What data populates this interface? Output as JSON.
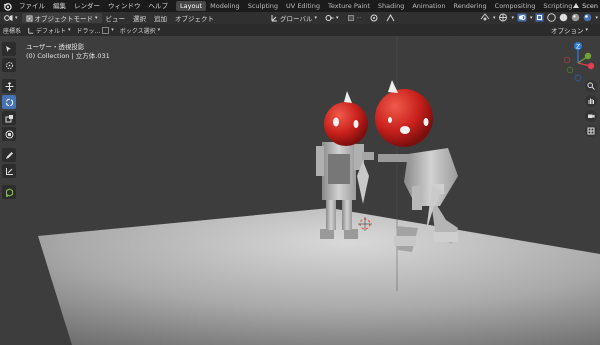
{
  "menubar": {
    "menus": [
      "ファイル",
      "編集",
      "レンダー",
      "ウィンドウ",
      "ヘルプ"
    ],
    "workspaces": [
      "Layout",
      "Modeling",
      "Sculpting",
      "UV Editing",
      "Texture Paint",
      "Shading",
      "Animation",
      "Rendering",
      "Compositing",
      "Scripting"
    ],
    "active_workspace": "Layout",
    "plus": "+",
    "scene": "Scen"
  },
  "header": {
    "mode": "オブジェクトモード",
    "menus": [
      "ビュー",
      "選択",
      "追加",
      "オブジェクト"
    ],
    "transform_orientation": "グローバル"
  },
  "toolsettings": {
    "coordinate": "座標系",
    "orientation": "デフォルト",
    "drag_label": "ドラッ...",
    "select": "ボックス選択",
    "options": "オプション"
  },
  "viewport": {
    "view_name": "ユーザー・透視投影",
    "collection_info": "(0) Collection | 立方体.031"
  },
  "gizmo": {
    "z_label": "Z",
    "x_color": "#e43d4f",
    "y_color": "#6fa533",
    "z_color": "#2e7bd6"
  },
  "colors": {
    "accent": "#4772b3",
    "head_red": "#c8201c"
  }
}
